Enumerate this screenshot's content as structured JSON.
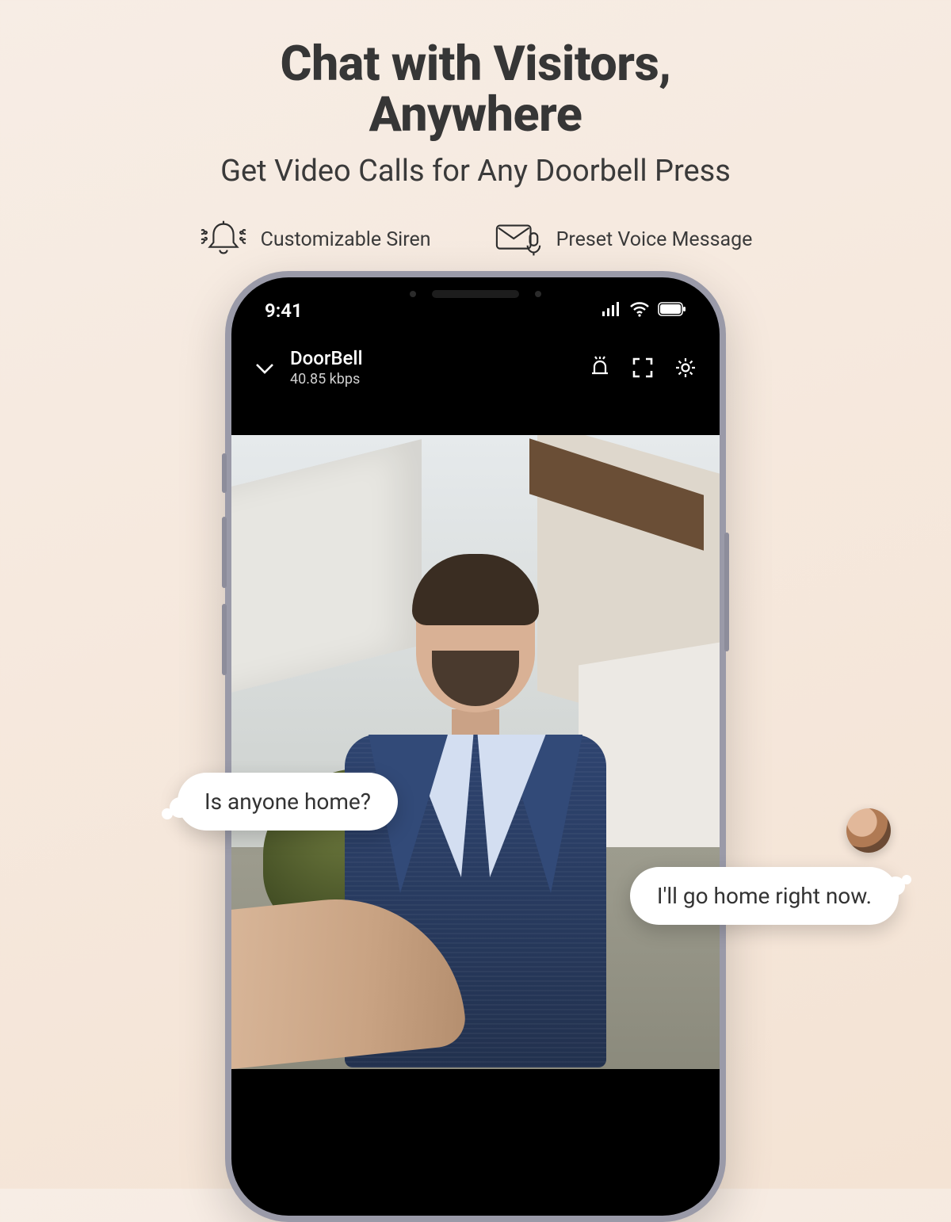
{
  "hero": {
    "title_line1": "Chat with Visitors,",
    "title_line2": "Anywhere",
    "subtitle": "Get Video Calls for Any Doorbell Press"
  },
  "features": {
    "siren": "Customizable Siren",
    "voice": "Preset Voice Message"
  },
  "statusbar": {
    "time": "9:41"
  },
  "app_header": {
    "device_name": "DoorBell",
    "bitrate": "40.85 kbps"
  },
  "chat": {
    "visitor": "Is anyone home?",
    "owner": "I'll go home right now."
  }
}
